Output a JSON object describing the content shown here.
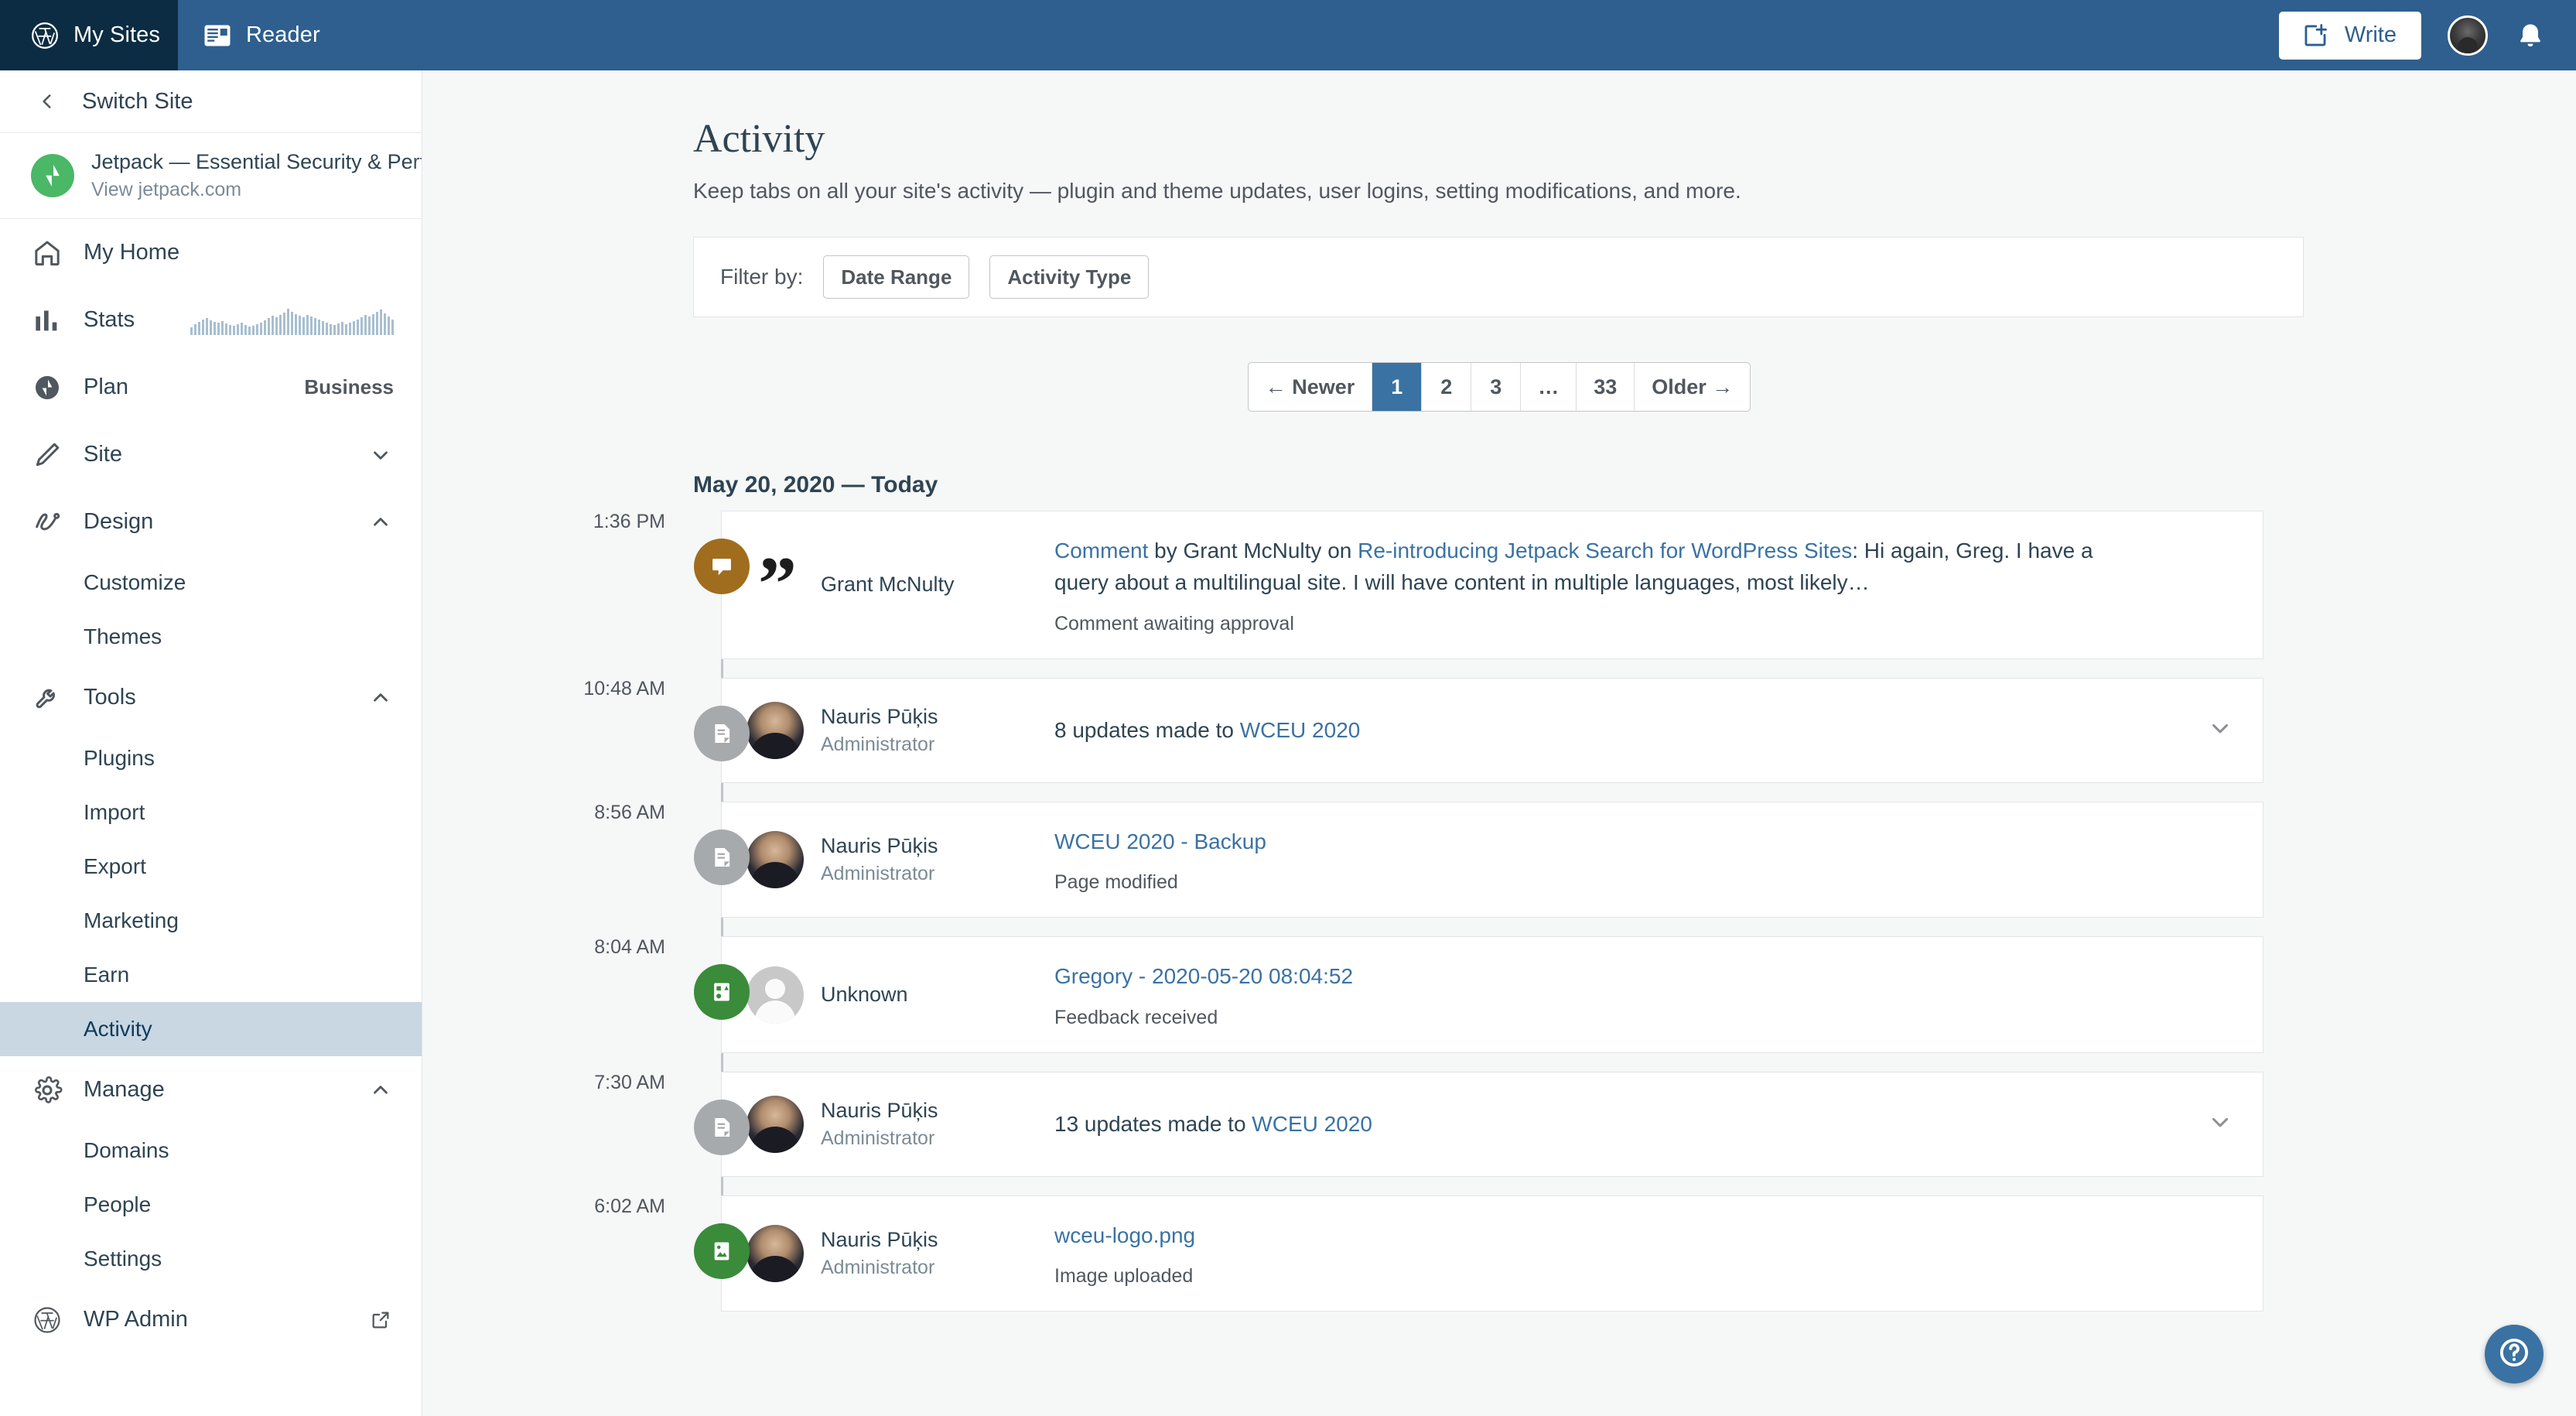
{
  "masthead": {
    "my_sites_label": "My Sites",
    "reader_label": "Reader",
    "write_label": "Write",
    "wordpress_icon": "wordpress-icon",
    "reader_icon": "reader-icon",
    "write_icon": "write-icon",
    "avatar_icon": "user-avatar",
    "notifications_icon": "bell-icon",
    "bg_color": "#2e5f8e",
    "my_sites_bg_color": "#0b2c42"
  },
  "sidebar": {
    "switch_site_label": "Switch Site",
    "switch_site_icon": "chevron-left-icon",
    "site": {
      "name": "Jetpack — Essential Security & Performance",
      "url": "View jetpack.com",
      "logo_icon": "jetpack-icon",
      "logo_color": "#4ab866"
    },
    "items": [
      {
        "label": "My Home",
        "icon": "home-icon",
        "meta": "",
        "chevron": "",
        "type": "item"
      },
      {
        "label": "Stats",
        "icon": "stats-icon",
        "meta": "",
        "chevron": "",
        "type": "item",
        "sparkline": true
      },
      {
        "label": "Plan",
        "icon": "plan-icon",
        "meta": "Business",
        "chevron": "",
        "type": "item"
      },
      {
        "label": "Site",
        "icon": "pencil-icon",
        "meta": "",
        "chevron": "down",
        "type": "item"
      },
      {
        "label": "Design",
        "icon": "design-icon",
        "meta": "",
        "chevron": "up",
        "type": "item"
      },
      {
        "label": "Customize",
        "icon": "",
        "meta": "",
        "chevron": "",
        "type": "sub"
      },
      {
        "label": "Themes",
        "icon": "",
        "meta": "",
        "chevron": "",
        "type": "sub"
      },
      {
        "label": "Tools",
        "icon": "wrench-icon",
        "meta": "",
        "chevron": "up",
        "type": "item"
      },
      {
        "label": "Plugins",
        "icon": "",
        "meta": "",
        "chevron": "",
        "type": "sub"
      },
      {
        "label": "Import",
        "icon": "",
        "meta": "",
        "chevron": "",
        "type": "sub"
      },
      {
        "label": "Export",
        "icon": "",
        "meta": "",
        "chevron": "",
        "type": "sub"
      },
      {
        "label": "Marketing",
        "icon": "",
        "meta": "",
        "chevron": "",
        "type": "sub"
      },
      {
        "label": "Earn",
        "icon": "",
        "meta": "",
        "chevron": "",
        "type": "sub"
      },
      {
        "label": "Activity",
        "icon": "",
        "meta": "",
        "chevron": "",
        "type": "sub",
        "selected": true
      },
      {
        "label": "Manage",
        "icon": "gear-icon",
        "meta": "",
        "chevron": "up",
        "type": "item"
      },
      {
        "label": "Domains",
        "icon": "",
        "meta": "",
        "chevron": "",
        "type": "sub"
      },
      {
        "label": "People",
        "icon": "",
        "meta": "",
        "chevron": "",
        "type": "sub"
      },
      {
        "label": "Settings",
        "icon": "",
        "meta": "",
        "chevron": "",
        "type": "sub"
      },
      {
        "label": "WP Admin",
        "icon": "wordpress-icon",
        "meta": "",
        "chevron": "external",
        "type": "item"
      }
    ],
    "selected_color": "#c8d7e1"
  },
  "page": {
    "title": "Activity",
    "subtitle": "Keep tabs on all your site's activity — plugin and theme updates, user logins, setting modifications, and more.",
    "filter_label": "Filter by:",
    "filters": [
      {
        "label": "Date Range"
      },
      {
        "label": "Activity Type"
      }
    ]
  },
  "pagination": {
    "newer_label": "← Newer",
    "older_label": "Older →",
    "pages": [
      "1",
      "2",
      "3",
      "…",
      "33"
    ],
    "current": "1",
    "active_color": "#3a72a3"
  },
  "activity": {
    "day_heading": "May 20, 2020 — Today",
    "entries": [
      {
        "time": "1:36 PM",
        "badge_icon": "comment-icon",
        "badge_color": "#9f6d1d",
        "avatar_type": "quote",
        "actor_name": "Grant McNulty",
        "actor_role": "",
        "text_prefix_link": "Comment",
        "text_mid": " by Grant McNulty on ",
        "text_link2": "Re-introducing Jetpack Search for WordPress Sites",
        "text_suffix": ": Hi again, Greg. I have a query about a multilingual site. I will have content in multiple languages, most likely…",
        "note": "Comment awaiting approval",
        "chevron": false
      },
      {
        "time": "10:48 AM",
        "badge_icon": "document-icon",
        "badge_color": "#a7aaad",
        "avatar_type": "photo",
        "actor_name": "Nauris Pūķis",
        "actor_role": "Administrator",
        "text_prefix": "8 updates made to ",
        "text_link": "WCEU 2020",
        "note": "",
        "chevron": true
      },
      {
        "time": "8:56 AM",
        "badge_icon": "document-icon",
        "badge_color": "#a7aaad",
        "avatar_type": "photo",
        "actor_name": "Nauris Pūķis",
        "actor_role": "Administrator",
        "text_link": "WCEU 2020 - Backup",
        "note": "Page modified",
        "chevron": false
      },
      {
        "time": "8:04 AM",
        "badge_icon": "feedback-icon",
        "badge_color": "#3a8b3a",
        "avatar_type": "anon",
        "actor_name": "Unknown",
        "actor_role": "",
        "text_link": "Gregory - 2020-05-20 08:04:52",
        "note": "Feedback received",
        "chevron": false
      },
      {
        "time": "7:30 AM",
        "badge_icon": "document-icon",
        "badge_color": "#a7aaad",
        "avatar_type": "photo",
        "actor_name": "Nauris Pūķis",
        "actor_role": "Administrator",
        "text_prefix": "13 updates made to ",
        "text_link": "WCEU 2020",
        "note": "",
        "chevron": true
      },
      {
        "time": "6:02 AM",
        "badge_icon": "image-icon",
        "badge_color": "#3a8b3a",
        "avatar_type": "photo",
        "actor_name": "Nauris Pūķis",
        "actor_role": "Administrator",
        "text_link": "wceu-logo.png",
        "note": "Image uploaded",
        "chevron": false
      }
    ]
  },
  "help": {
    "icon": "help-icon",
    "color": "#3a72a3"
  }
}
